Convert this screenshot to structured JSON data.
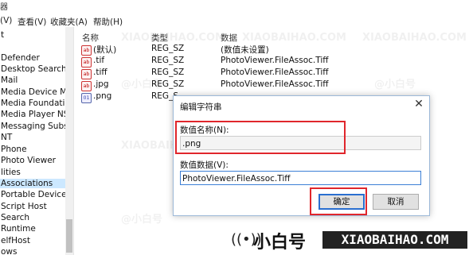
{
  "window": {
    "title_fragment": "器",
    "menu": [
      "(V)",
      "查看(V)",
      "收藏夹(A)",
      "帮助(H)"
    ]
  },
  "tree": {
    "items": [
      "t",
      "Defender",
      "Desktop Search",
      "Mail",
      "Media Device Mana",
      "Media Foundation",
      "Media Player NSS",
      "Messaging Subsyst",
      "NT",
      "Phone",
      "Photo Viewer",
      "lities",
      "Associations",
      "Portable Devices",
      "Script Host",
      "Search",
      "Runtime",
      "elfHost",
      "ows"
    ],
    "selected": "Associations"
  },
  "list": {
    "headers": {
      "name": "名称",
      "type": "类型",
      "data": "数据"
    },
    "rows": [
      {
        "icon": "string-value-icon",
        "name": "(默认)",
        "type": "REG_SZ",
        "data": "(数值未设置)"
      },
      {
        "icon": "string-value-icon",
        "name": ".tif",
        "type": "REG_SZ",
        "data": "PhotoViewer.FileAssoc.Tiff"
      },
      {
        "icon": "string-value-icon",
        "name": ".tiff",
        "type": "REG_SZ",
        "data": "PhotoViewer.FileAssoc.Tiff"
      },
      {
        "icon": "string-value-icon",
        "name": ".jpg",
        "type": "REG_SZ",
        "data": "PhotoViewer.FileAssoc.Tiff"
      },
      {
        "icon": "binary-value-icon",
        "name": ".png",
        "type": "REG_S",
        "data": ""
      }
    ]
  },
  "dialog": {
    "title": "编辑字符串",
    "name_label": "数值名称(N):",
    "name_value": ".png",
    "data_label": "数值数据(V):",
    "data_value": "PhotoViewer.FileAssoc.Tiff",
    "ok_label": "确定",
    "cancel_label": "取消",
    "close_glyph": "✕",
    "highlight_color": "#e0262c"
  },
  "watermark": {
    "brand_cn": "小白号",
    "brand_en": "XIAOBAIHAO.COM",
    "tile_cn": "@小白号",
    "tile_en": "XIAOBAIHAO.COM"
  }
}
